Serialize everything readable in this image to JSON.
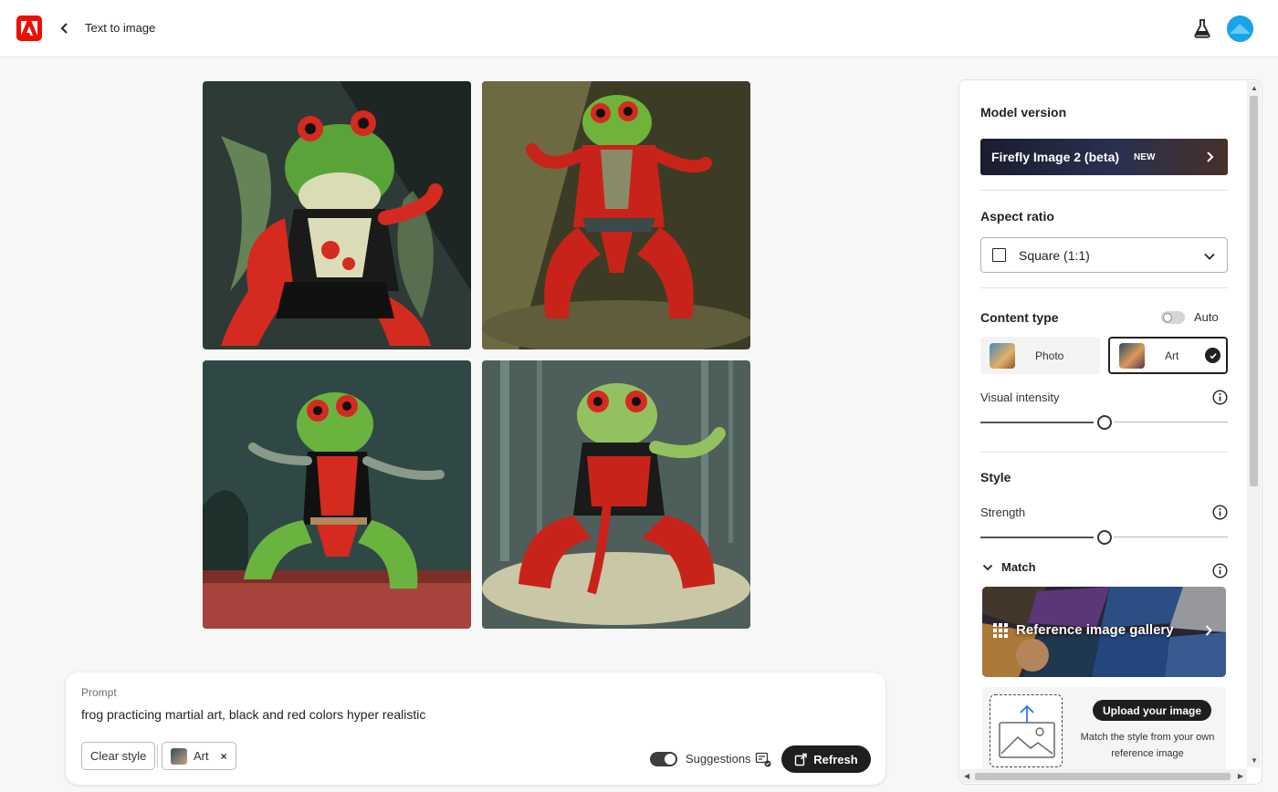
{
  "header": {
    "app_logo": "adobe-logo-icon",
    "title": "Text to image"
  },
  "gallery_images": [
    {
      "name": "generated-image-1",
      "bg": "#3b4a44",
      "accent": "#d42a20"
    },
    {
      "name": "generated-image-2",
      "bg": "#5b5a3a",
      "accent": "#d42a20"
    },
    {
      "name": "generated-image-3",
      "bg": "#2f4a48",
      "accent": "#d42a20"
    },
    {
      "name": "generated-image-4",
      "bg": "#5a6a66",
      "accent": "#d42a20"
    }
  ],
  "prompt": {
    "label": "Prompt",
    "text": "frog practicing martial art, black and red colors hyper realistic",
    "clear_style_label": "Clear style",
    "style_chip_label": "Art",
    "style_chip_remove": "×",
    "suggestions_label": "Suggestions",
    "suggestions_on": true,
    "refresh_label": "Refresh"
  },
  "panel": {
    "model": {
      "title": "Model version",
      "value": "Firefly Image 2 (beta)",
      "badge": "NEW"
    },
    "aspect": {
      "title": "Aspect ratio",
      "value": "Square (1:1)"
    },
    "content_type": {
      "title": "Content type",
      "auto_label": "Auto",
      "auto_on": false,
      "options": [
        {
          "label": "Photo",
          "selected": false
        },
        {
          "label": "Art",
          "selected": true
        }
      ]
    },
    "visual_intensity": {
      "label": "Visual intensity",
      "value": 0.5
    },
    "style": {
      "title": "Style",
      "strength_label": "Strength",
      "strength_value": 0.5,
      "match_label": "Match",
      "gallery_label": "Reference image gallery",
      "upload_button": "Upload your image",
      "upload_desc": "Match the style from your own reference image"
    }
  },
  "colors": {
    "accent": "#eb1000",
    "dark_button": "#1e1e1e",
    "avatar": "#1aa3e8"
  }
}
